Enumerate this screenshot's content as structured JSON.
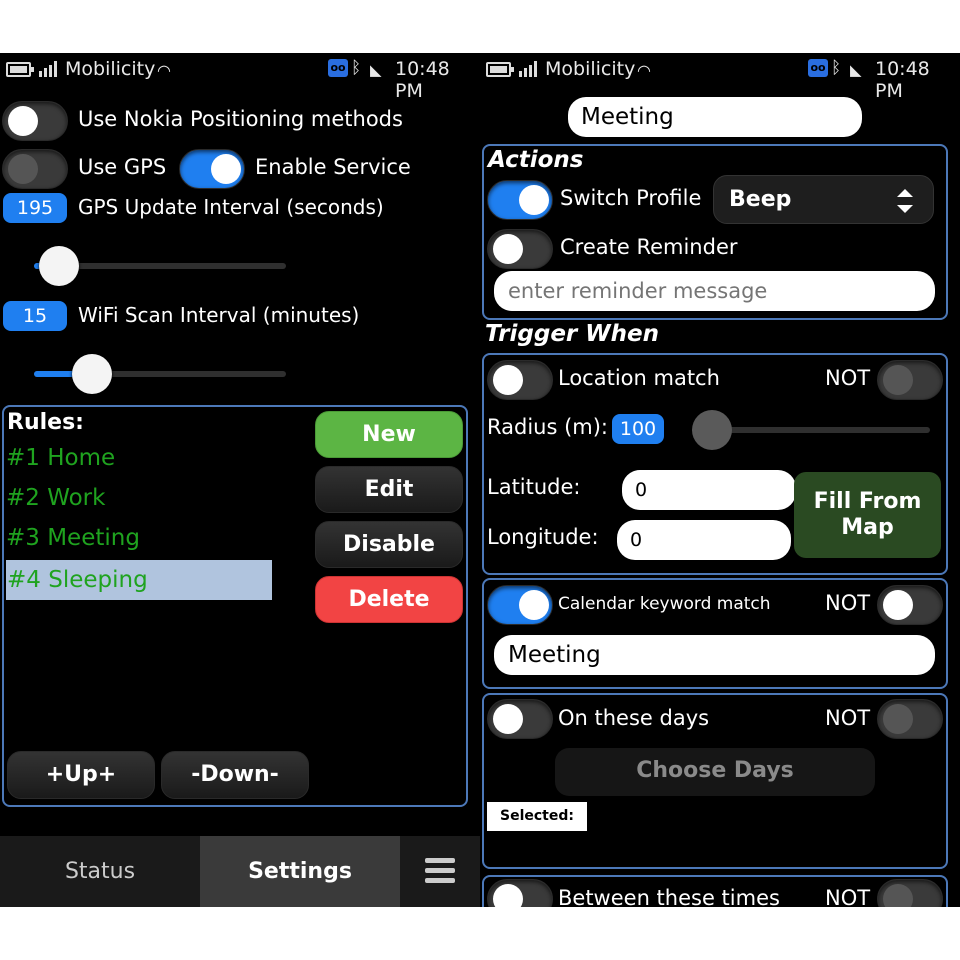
{
  "status_bar": {
    "carrier": "Mobilicity",
    "time": "10:48 PM"
  },
  "settings_screen": {
    "nokia_positioning": {
      "label": "Use Nokia Positioning methods",
      "on": false
    },
    "use_gps": {
      "label": "Use GPS",
      "on": false
    },
    "enable_service": {
      "label": "Enable Service",
      "on": true
    },
    "gps_interval": {
      "value": "195",
      "label": "GPS Update Interval (seconds)",
      "slider_fraction": 0.1
    },
    "wifi_interval": {
      "value": "15",
      "label": "WiFi Scan Interval (minutes)",
      "slider_fraction": 0.23
    },
    "rules": {
      "header": "Rules:",
      "items": [
        "#1 Home",
        "#2 Work",
        "#3 Meeting",
        "#4 Sleeping"
      ],
      "selected_index": 3
    },
    "buttons": {
      "new": "New",
      "edit": "Edit",
      "disable": "Disable",
      "delete": "Delete",
      "up": "+Up+",
      "down": "-Down-"
    },
    "tabs": {
      "status": "Status",
      "settings": "Settings",
      "active": "Settings"
    },
    "colors": {
      "accent": "#1f7ff0",
      "rule_text": "#1fa31f",
      "new_button": "#5cb544",
      "delete_button": "#f24444",
      "selected_rule": "#b0c4de"
    }
  },
  "rule_editor": {
    "rule_name": "Meeting",
    "actions": {
      "header": "Actions",
      "switch_profile": {
        "label": "Switch Profile",
        "on": true,
        "value": "Beep"
      },
      "create_reminder": {
        "label": "Create Reminder",
        "on": false,
        "placeholder": "enter reminder message"
      }
    },
    "trigger": {
      "header": "Trigger When",
      "not_label": "NOT",
      "location": {
        "label": "Location match",
        "on": false,
        "radius_label": "Radius (m):",
        "radius_value": "100",
        "latitude_label": "Latitude:",
        "latitude_value": "0",
        "longitude_label": "Longitude:",
        "longitude_value": "0",
        "fill_from_map": "Fill From Map"
      },
      "calendar": {
        "label": "Calendar keyword match",
        "on": true,
        "keyword": "Meeting"
      },
      "days": {
        "label": "On these days",
        "on": false,
        "choose_button": "Choose Days",
        "selected_label": "Selected:"
      },
      "times": {
        "label": "Between these times",
        "on": false
      }
    }
  }
}
